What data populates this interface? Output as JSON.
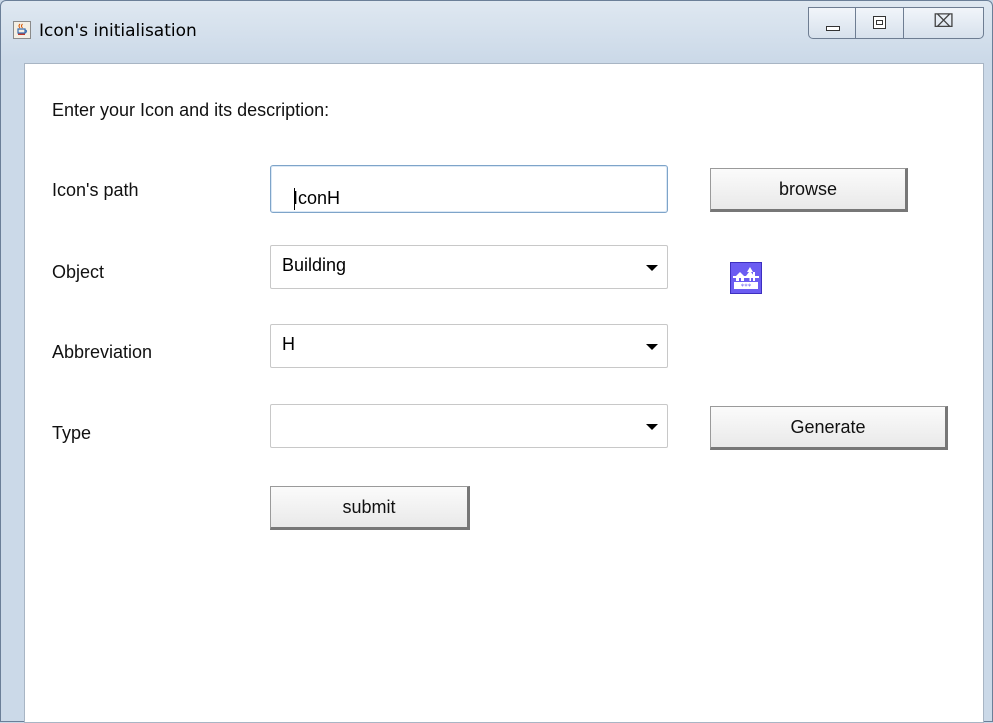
{
  "window": {
    "title": "Icon's initialisation",
    "title_icon": "java-coffee-cup-icon",
    "controls": {
      "minimize": "minimize-icon",
      "maximize": "maximize-icon",
      "close": "close-icon",
      "close_glyph": "⌧"
    }
  },
  "form": {
    "heading": "Enter your Icon and its description:",
    "icon_path": {
      "label": "Icon's path",
      "value": "IconH"
    },
    "browse_label": "browse",
    "object": {
      "label": "Object",
      "value": "Building"
    },
    "preview_icon": "building-trees-icon",
    "abbreviation": {
      "label": "Abbreviation",
      "value": "H"
    },
    "type": {
      "label": "Type",
      "value": ""
    },
    "generate_label": "Generate",
    "submit_label": "submit"
  },
  "colors": {
    "preview_icon_bg": "#6b5cf2",
    "window_frame": "#cbd9e8"
  }
}
